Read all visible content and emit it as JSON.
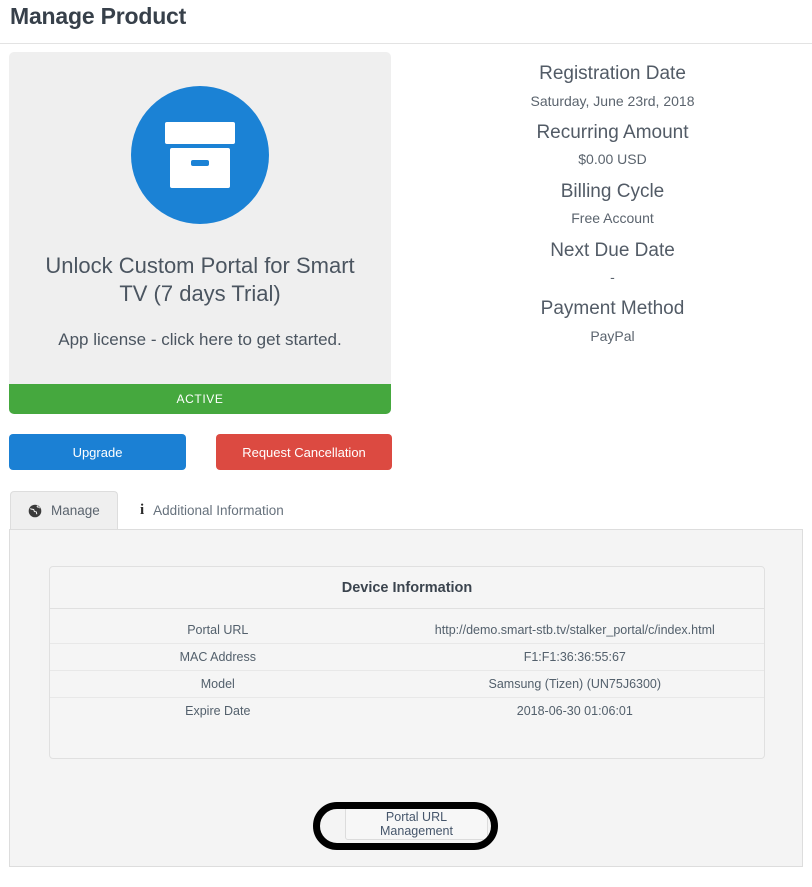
{
  "header": {
    "title": "Manage Product"
  },
  "product": {
    "icon": "archive-box-icon",
    "title": "Unlock Custom Portal for Smart TV (7 days Trial)",
    "subtitle": "App license - click here to get started.",
    "status": "ACTIVE",
    "status_color": "#45a83e",
    "icon_color": "#1b82d5"
  },
  "summary": [
    {
      "label": "Registration Date",
      "value": "Saturday, June 23rd, 2018"
    },
    {
      "label": "Recurring Amount",
      "value": "$0.00 USD"
    },
    {
      "label": "Billing Cycle",
      "value": "Free Account"
    },
    {
      "label": "Next Due Date",
      "value": "-"
    },
    {
      "label": "Payment Method",
      "value": "PayPal"
    }
  ],
  "actions": {
    "upgrade_label": "Upgrade",
    "upgrade_color": "#1b80d4",
    "cancel_label": "Request Cancellation",
    "cancel_color": "#dc4a41"
  },
  "tabs": [
    {
      "label": "Manage",
      "icon": "globe-icon",
      "active": true
    },
    {
      "label": "Additional Information",
      "icon": "info-icon",
      "active": false
    }
  ],
  "device_information": {
    "heading": "Device Information",
    "rows": [
      {
        "label": "Portal URL",
        "value": "http://demo.smart-stb.tv/stalker_portal/c/index.html"
      },
      {
        "label": "MAC Address",
        "value": "F1:F1:36:36:55:67"
      },
      {
        "label": "Model",
        "value": "Samsung (Tizen) (UN75J6300)"
      },
      {
        "label": "Expire Date",
        "value": "2018-06-30 01:06:01"
      }
    ]
  },
  "portal_button": {
    "label": "Portal URL Management"
  },
  "annotation": {
    "shape": "hand-drawn-ellipse",
    "color": "#000000"
  }
}
